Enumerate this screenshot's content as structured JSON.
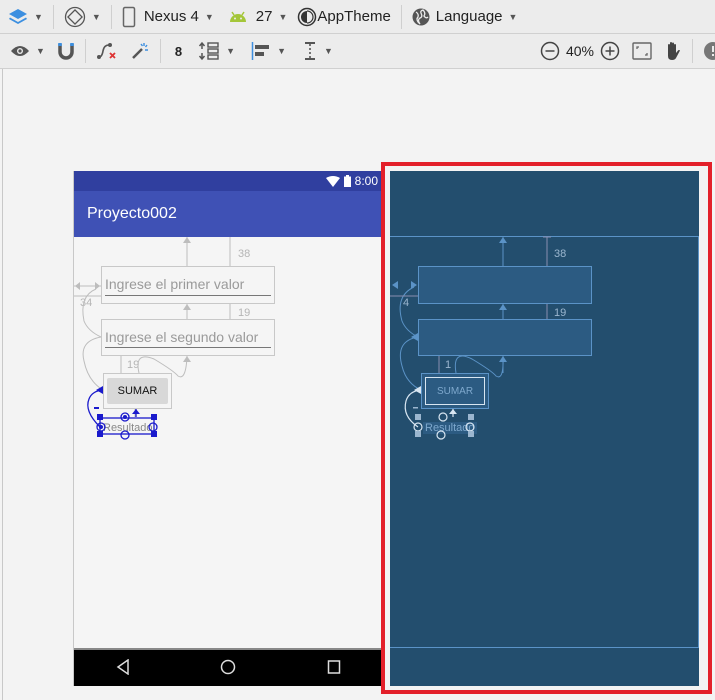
{
  "toolbar_top": {
    "layers_icon": "layers-icon",
    "orientation_icon": "rotate-device-icon",
    "device": "Nexus 4",
    "api_level": "27",
    "theme": "AppTheme",
    "language": "Language"
  },
  "toolbar_bottom": {
    "margin_value": "8",
    "zoom_level": "40%"
  },
  "phone": {
    "status_time": "8:00",
    "app_title": "Proyecto002",
    "fields": [
      {
        "hint": "Ingrese el primer valor"
      },
      {
        "hint": "Ingrese el segundo valor"
      }
    ],
    "button_label": "SUMAR",
    "result_label": "Resultado",
    "dims": {
      "top_margin": "38",
      "left_margin": "34",
      "second_margin": "19",
      "button_margin": "19"
    }
  },
  "blueprint": {
    "button_label": "SUMAR",
    "result_label": "Resultado",
    "dims": {
      "top_margin": "38",
      "left_margin": "4",
      "second_margin": "19",
      "button_margin": "1"
    }
  },
  "colors": {
    "status_bar": "#303f9f",
    "app_bar": "#3f51b5",
    "blueprint_bg": "#234e6e",
    "selection_frame": "#e3202a",
    "constraint_selected": "#1a1acc"
  }
}
